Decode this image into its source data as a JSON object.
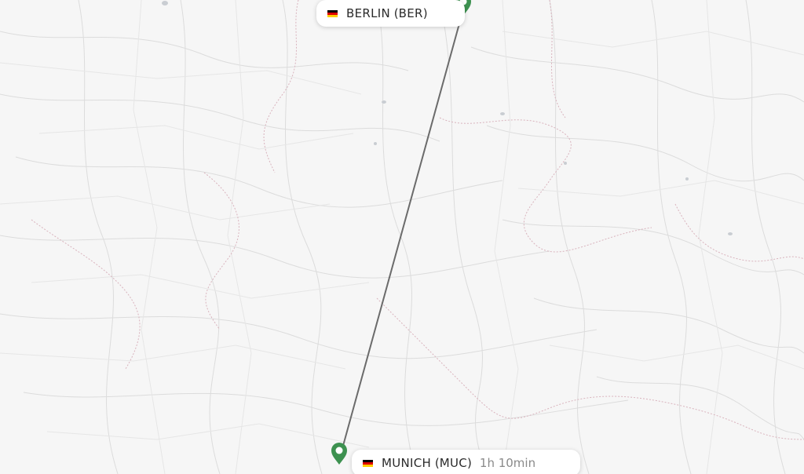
{
  "map": {
    "land_color": "#f6f6f6",
    "border_color": "#d9b3bd",
    "road_color": "#dadada",
    "water_color": "#c9cdd2",
    "route_color": "#6b6b6b",
    "pin_color": "#3d9150"
  },
  "origin": {
    "city": "BERLIN",
    "code": "BER",
    "flag_icon": "germany-flag-icon"
  },
  "destination": {
    "city": "MUNICH",
    "code": "MUC",
    "flag_icon": "germany-flag-icon",
    "duration": "1h 10min"
  },
  "flag_colors": [
    "#000000",
    "#dd0000",
    "#ffce00"
  ]
}
